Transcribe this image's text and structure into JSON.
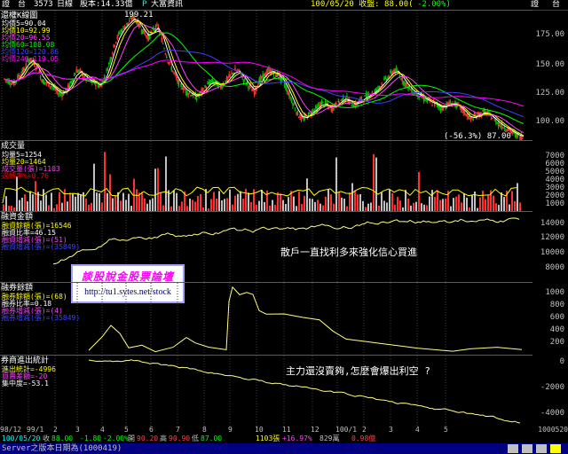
{
  "header": {
    "left_label": "證　台",
    "stock_code": "3573",
    "period": "日線",
    "capital_label": "股本:14.33億",
    "flag": "P",
    "broker": "大富資訊",
    "date_info": "100/05/20 收盤: 88.00(",
    "change_info": "-2.00%)",
    "right_label_1": "證",
    "right_label_2": "台"
  },
  "price_panel": {
    "title": "還權K線圖",
    "peak_label": "199.21",
    "low_label": "(-56.3%) 87.00",
    "ma": [
      {
        "label": "均價5",
        "value": "=90.04",
        "color": "#ffffff"
      },
      {
        "label": "均價10",
        "value": "=92.99",
        "color": "#ffff00"
      },
      {
        "label": "均價20",
        "value": "=96.55",
        "color": "#ff40ff"
      },
      {
        "label": "均價60",
        "value": "=108.08",
        "color": "#00ff00"
      },
      {
        "label": "均價120",
        "value": "=120.86",
        "color": "#4040ff"
      },
      {
        "label": "均價240",
        "value": "=119.05",
        "color": "#ff00ff"
      }
    ],
    "yticks": [
      "175.00",
      "150.00",
      "125.00",
      "100.00"
    ]
  },
  "volume_panel": {
    "title": "成交量",
    "legend": [
      {
        "label": "均量5",
        "value": "=1254",
        "color": "#ffffff"
      },
      {
        "label": "均量20",
        "value": "=1464",
        "color": "#ffff00"
      },
      {
        "label": "成交量(張)",
        "value": "=1103",
        "color": "#ff40ff"
      },
      {
        "label": "週轉率%",
        "value": "=0.76",
        "color": "#ff0000"
      }
    ],
    "yticks": [
      "7000",
      "6000",
      "5000",
      "4000",
      "3000",
      "2000",
      "1000"
    ]
  },
  "margin_panel": {
    "title": "融資金額",
    "legend": [
      {
        "label": "融資餘額(張)",
        "value": "=16546",
        "color": "#ffff00"
      },
      {
        "label": "融資比率",
        "value": "=46.15",
        "color": "#ffffff"
      },
      {
        "label": "融資增減(張)",
        "value": "=(51)",
        "color": "#ff40ff"
      },
      {
        "label": "融資增減(張)",
        "value": "=(35849)",
        "color": "#4040ff"
      }
    ],
    "yticks": [
      "14000",
      "12000",
      "10000",
      "8000"
    ],
    "note": "散戶一直找利多來強化信心買進"
  },
  "ad": {
    "title": "談股說金股票論壇",
    "url": "http://tu1.sytes.net/stock"
  },
  "short_panel": {
    "title": "融券餘額",
    "legend": [
      {
        "label": "融券餘額(張)",
        "value": "=(68)",
        "color": "#ffff00"
      },
      {
        "label": "融券比率",
        "value": "=0.18",
        "color": "#ffffff"
      },
      {
        "label": "融券增減(張)",
        "value": "=(4)",
        "color": "#ff40ff"
      },
      {
        "label": "融券增減(張)",
        "value": "=(35849)",
        "color": "#4040ff"
      }
    ],
    "yticks": [
      "1000",
      "800",
      "600",
      "400",
      "200"
    ]
  },
  "broker_panel": {
    "title": "券商進出統計",
    "legend": [
      {
        "label": "進出統計",
        "value": "=-4996",
        "color": "#ffff00"
      },
      {
        "label": "買賣差額",
        "value": "=-20",
        "color": "#ff40ff"
      },
      {
        "label": "集中度",
        "value": "=-53.1",
        "color": "#ffffff"
      }
    ],
    "yticks": [
      "0",
      "-2000",
      "-4000"
    ],
    "note": "主力還沒賣夠,怎麼會爆出利空 ?"
  },
  "xaxis": {
    "labels": [
      "98/12",
      "99/1",
      "2",
      "3",
      "4",
      "5",
      "6",
      "7",
      "8",
      "9",
      "10",
      "11",
      "12",
      "100/1",
      "2",
      "3",
      "4",
      "5"
    ],
    "right_label": "1000520"
  },
  "bottom_quote": {
    "date": "100/05/20",
    "close_label": "收",
    "close": "88.00",
    "chg": "-1.80",
    "chg_pct": "-2.00%",
    "open_label": "開",
    "open": "90.20",
    "high_label": "高",
    "high": "90.90",
    "low_label": "低",
    "low": "87.00",
    "vol": "1103張",
    "vol_pct": "+16.97%",
    "amt": "829萬",
    "turnover": "0.98億"
  },
  "status": {
    "text": "Server之版本日期為(1000419)"
  },
  "chart_data": {
    "type": "line",
    "title": "還權K線圖",
    "ylim": [
      85,
      205
    ],
    "price": [
      142,
      140,
      138,
      145,
      150,
      160,
      158,
      150,
      140,
      138,
      135,
      130,
      128,
      132,
      140,
      150,
      148,
      142,
      140,
      138,
      135,
      145,
      160,
      175,
      185,
      190,
      195,
      199,
      192,
      185,
      180,
      188,
      190,
      175,
      160,
      150,
      140,
      135,
      130,
      128,
      125,
      130,
      135,
      140,
      138,
      135,
      140,
      145,
      150,
      148,
      140,
      135,
      130,
      140,
      145,
      150,
      148,
      145,
      140,
      130,
      120,
      110,
      105,
      108,
      112,
      115,
      120,
      118,
      115,
      118,
      122,
      125,
      120,
      118,
      122,
      125,
      128,
      130,
      135,
      140,
      145,
      150,
      148,
      140,
      135,
      130,
      128,
      125,
      122,
      120,
      118,
      115,
      118,
      120,
      118,
      115,
      110,
      105,
      108,
      110,
      112,
      108,
      105,
      100,
      98,
      95,
      92,
      90,
      88
    ]
  }
}
